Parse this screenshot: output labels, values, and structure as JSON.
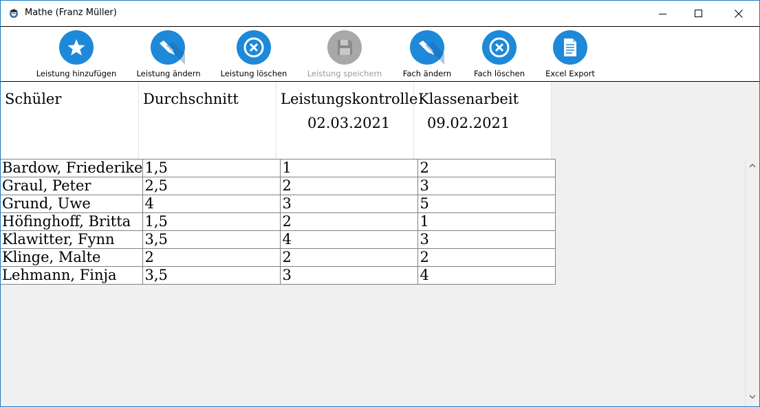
{
  "window": {
    "title": "Mathe (Franz Müller)"
  },
  "toolbar": {
    "items": [
      {
        "label": "Leistung hinzufügen",
        "icon": "star-icon",
        "enabled": true
      },
      {
        "label": "Leistung ändern",
        "icon": "pencil-icon",
        "enabled": true
      },
      {
        "label": "Leistung löschen",
        "icon": "delete-icon",
        "enabled": true
      },
      {
        "label": "Leistung speichern",
        "icon": "save-icon",
        "enabled": false
      },
      {
        "label": "Fach ändern",
        "icon": "pencil-icon",
        "enabled": true
      },
      {
        "label": "Fach löschen",
        "icon": "delete-icon",
        "enabled": true
      },
      {
        "label": "Excel Export",
        "icon": "document-icon",
        "enabled": true
      }
    ]
  },
  "grid": {
    "headers": [
      {
        "line1": "Schüler",
        "line2": ""
      },
      {
        "line1": "Durchschnitt",
        "line2": ""
      },
      {
        "line1": "Leistungskontrolle",
        "line2": "02.03.2021"
      },
      {
        "line1": "Klassenarbeit",
        "line2": "09.02.2021"
      }
    ],
    "rows": [
      [
        "Bardow, Friederike",
        "1,5",
        "1",
        "2"
      ],
      [
        "Graul, Peter",
        "2,5",
        "2",
        "3"
      ],
      [
        "Grund, Uwe",
        "4",
        "3",
        "5"
      ],
      [
        "Höfinghoff, Britta",
        "1,5",
        "2",
        "1"
      ],
      [
        "Klawitter, Fynn",
        "3,5",
        "4",
        "3"
      ],
      [
        "Klinge, Malte",
        "2",
        "2",
        "2"
      ],
      [
        "Lehmann, Finja",
        "3,5",
        "3",
        "4"
      ]
    ]
  },
  "colors": {
    "accent": "#1e88d9",
    "disabled": "#a8a8a8",
    "window_border": "#1a78c2"
  }
}
